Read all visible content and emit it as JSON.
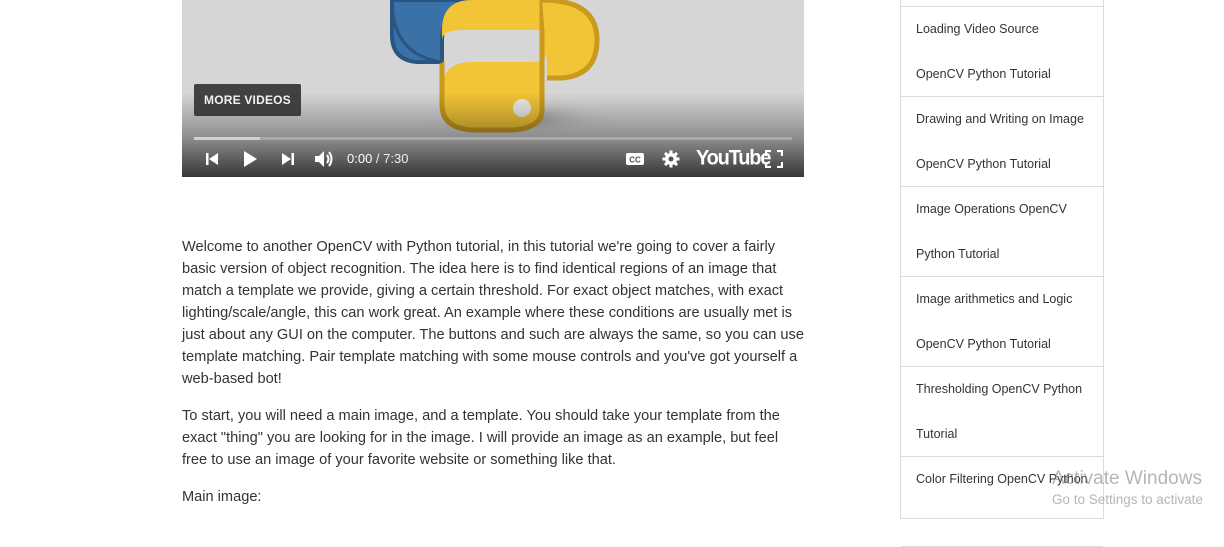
{
  "player": {
    "more_videos_label": "MORE VIDEOS",
    "current_time": "0:00",
    "separator": " / ",
    "duration": "7:30",
    "youtube_wordmark": "YouTube",
    "progress_loaded_fraction": 0.11,
    "icons": [
      "previous-icon",
      "play-icon",
      "next-icon",
      "volume-icon",
      "captions-icon",
      "settings-icon",
      "fullscreen-icon"
    ]
  },
  "article": {
    "paragraphs": [
      "Welcome to another OpenCV with Python tutorial, in this tutorial we're going to cover a fairly basic version of object recognition. The idea here is to find identical regions of an image that match a template we provide, giving a certain threshold. For exact object matches, with exact lighting/scale/angle, this can work great. An example where these conditions are usually met is just about any GUI on the computer. The buttons and such are always the same, so you can use template matching. Pair template matching with some mouse controls and you've got yourself a web-based bot!",
      "To start, you will need a main image, and a template. You should take your template from the exact \"thing\" you are looking for in the image. I will provide an image as an example, but feel free to use an image of your favorite website or something like that."
    ],
    "main_image_label": "Main image:"
  },
  "sidebar": {
    "items": [
      {
        "line1": "Loading Video Source",
        "line2": "OpenCV Python Tutorial"
      },
      {
        "line1": "Drawing and Writing on Image",
        "line2": "OpenCV Python Tutorial"
      },
      {
        "line1": "Image Operations OpenCV",
        "line2": "Python Tutorial"
      },
      {
        "line1": "Image arithmetics and Logic",
        "line2": "OpenCV Python Tutorial"
      },
      {
        "line1": "Thresholding OpenCV Python",
        "line2": "Tutorial"
      },
      {
        "line1": "Color Filtering OpenCV Python",
        "line2": ""
      }
    ]
  },
  "watermark": {
    "line1": "Activate Windows",
    "line2": "Go to Settings to activate"
  },
  "colors": {
    "python_blue": "#3a72a8",
    "python_yellow": "#f2c537",
    "player_bg": "#d6d6d6",
    "text": "#333333",
    "divider": "#dcdcdc"
  }
}
